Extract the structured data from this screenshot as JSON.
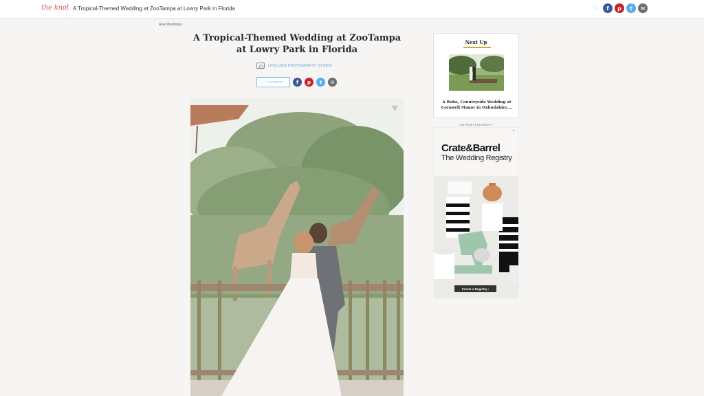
{
  "topbar": {
    "logo": "the knot",
    "title": "A Tropical-Themed Wedding at ZooTampa at Lowry Park in Florida"
  },
  "breadcrumb": "Real Weddings",
  "article": {
    "title": "A Tropical-Themed Wedding at ZooTampa at Lowry Park in Florida",
    "photo_credit": "LIFELONG PHOTOGRAPHY STUDIO",
    "favorite_label": "FAVORITE"
  },
  "share_icons": {
    "favorite": "heart-icon",
    "facebook": "f",
    "pinterest": "p",
    "twitter": "t",
    "email": "envelope"
  },
  "next_up": {
    "label": "Next Up",
    "caption": "A Boho, Countryside Wedding at Cornwell Manor in Oxfordshire,..."
  },
  "ad": {
    "label": "ADVERTISEMENT",
    "brand": "Crate&Barrel",
    "tagline": "The Wedding Registry",
    "cta": "Create a Registry ›"
  },
  "colors": {
    "accent_blue": "#5aa7d8",
    "facebook": "#3b5998",
    "pinterest": "#cb2027",
    "twitter": "#55acee",
    "email": "#6d6d6d",
    "next_up_bar": "#d5a53c",
    "logo_red": "#d9534f"
  }
}
